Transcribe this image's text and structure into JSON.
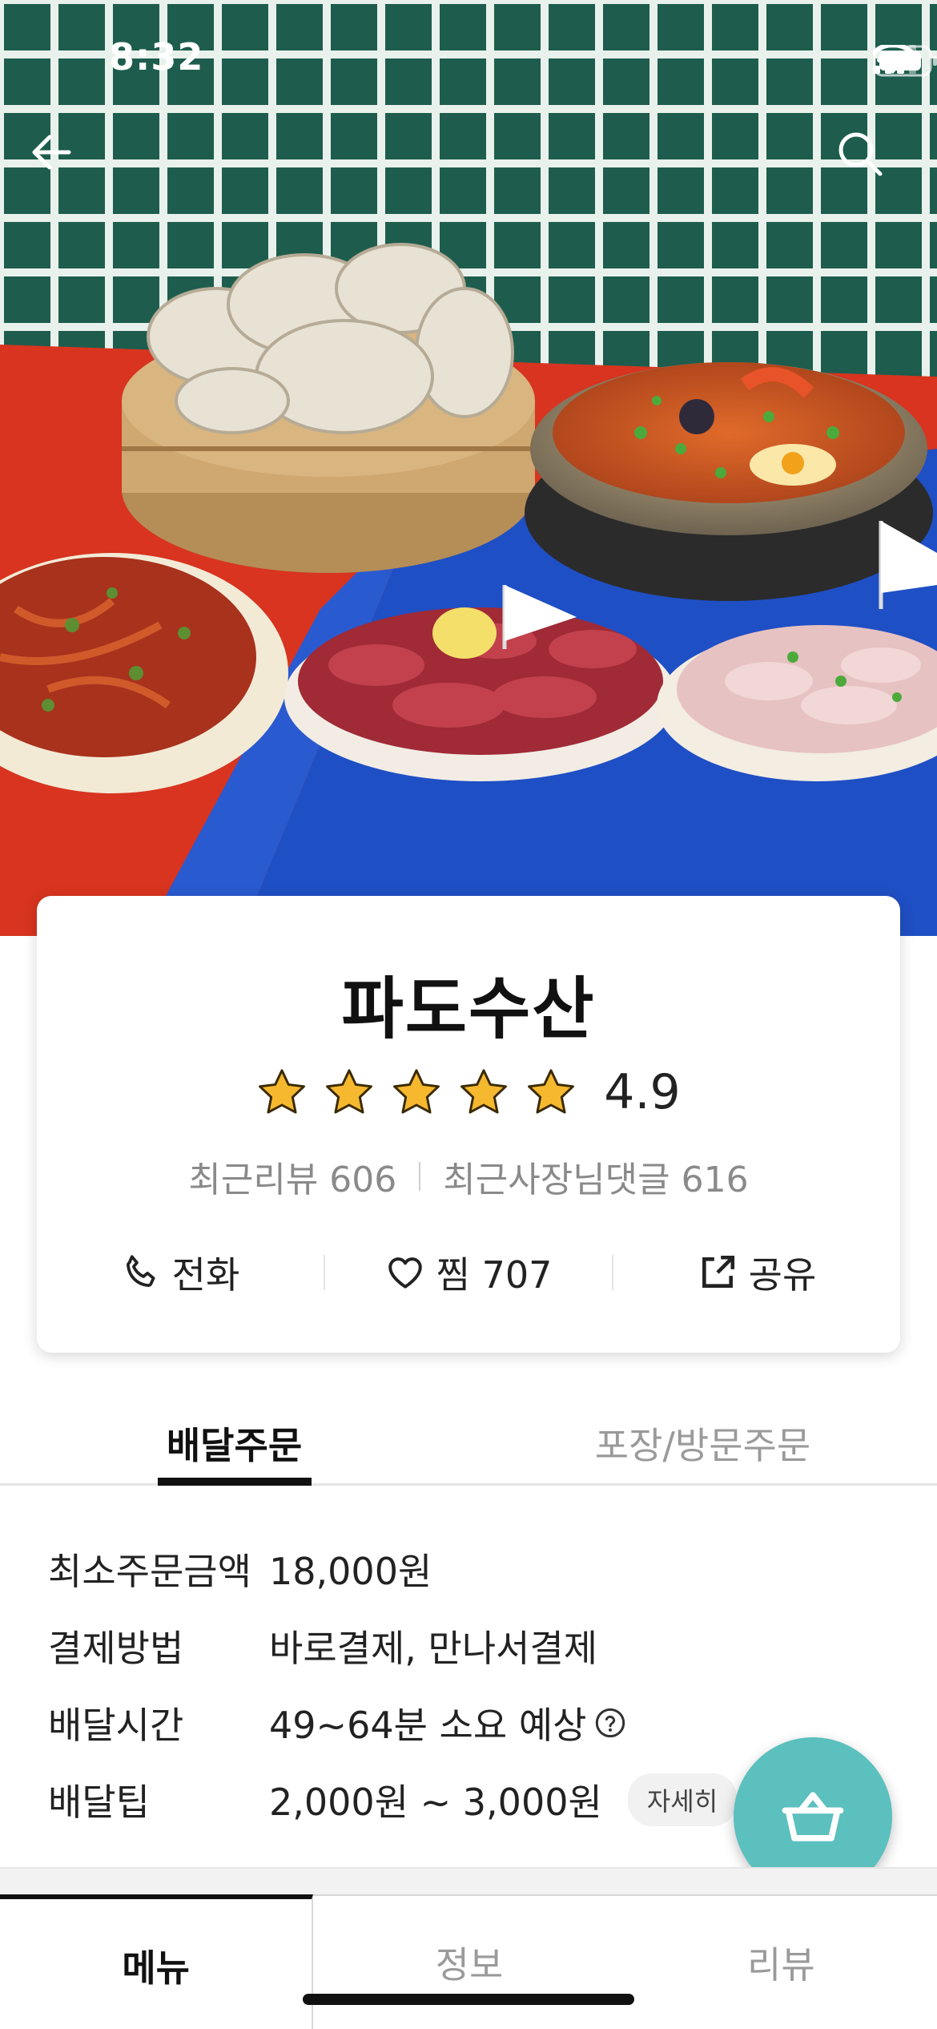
{
  "status_bar": {
    "time": "8:32"
  },
  "store": {
    "name": "파도수산",
    "rating": "4.9",
    "stars_filled": 5,
    "stars_total": 5,
    "recent_reviews": "최근리뷰 606",
    "owner_replies": "최근사장님댓글 616"
  },
  "actions": {
    "call": "전화",
    "like": "찜 707",
    "share": "공유"
  },
  "order_tabs": {
    "delivery": "배달주문",
    "pickup": "포장/방문주문"
  },
  "info": {
    "min_order_label": "최소주문금액",
    "min_order_value": "18,000원",
    "payment_label": "결제방법",
    "payment_value": "바로결제, 만나서결제",
    "delivery_time_label": "배달시간",
    "delivery_time_value": "49~64분 소요 예상",
    "delivery_tip_label": "배달팁",
    "delivery_tip_value": "2,000원 ~ 3,000원",
    "detail_chip": "자세히"
  },
  "bottom_tabs": {
    "menu": "메뉴",
    "info": "정보",
    "review": "리뷰"
  },
  "colors": {
    "accent": "#5bc0be",
    "star": "#f5b82e",
    "tile": "#1f5a4b",
    "table_red": "#d8341f",
    "table_blue": "#1f4fc4"
  },
  "icons": {
    "back": "arrow-left-icon",
    "search": "search-icon",
    "call": "phone-icon",
    "like": "heart-icon",
    "share": "share-icon",
    "help": "question-circle-icon",
    "cart": "basket-icon"
  }
}
